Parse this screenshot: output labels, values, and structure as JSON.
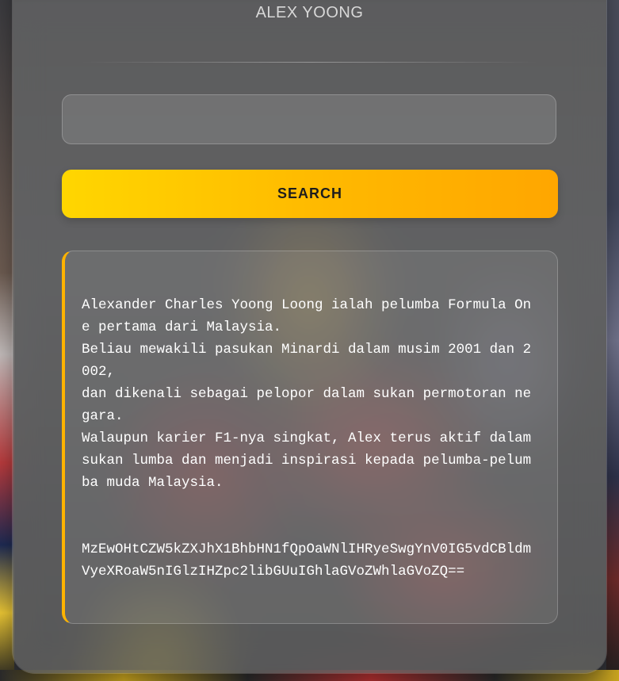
{
  "app": {
    "title": "ALEX YOONG"
  },
  "search": {
    "value": "",
    "placeholder": "",
    "button_label": "SEARCH"
  },
  "result": {
    "description": "Alexander Charles Yoong Loong ialah pelumba Formula One pertama dari Malaysia.\nBeliau mewakili pasukan Minardi dalam musim 2001 dan 2002,\ndan dikenali sebagai pelopor dalam sukan permotoran negara.\nWalaupun karier F1-nya singkat, Alex terus aktif dalam sukan lumba dan menjadi inspirasi kepada pelumba-pelumba muda Malaysia.",
    "encoded": "MzEwOHtCZW5kZXJhX1BhbHN1fQpOaWNlIHRyeSwgYnV0IG5vdCBldmVyeXRoaW5nIGlzIHZpc2libGUuIGhlaGVoZWhlaGVoZQ=="
  },
  "colors": {
    "accent": "#ffb800",
    "accent_start": "#ffd600",
    "accent_end": "#ffa600"
  }
}
